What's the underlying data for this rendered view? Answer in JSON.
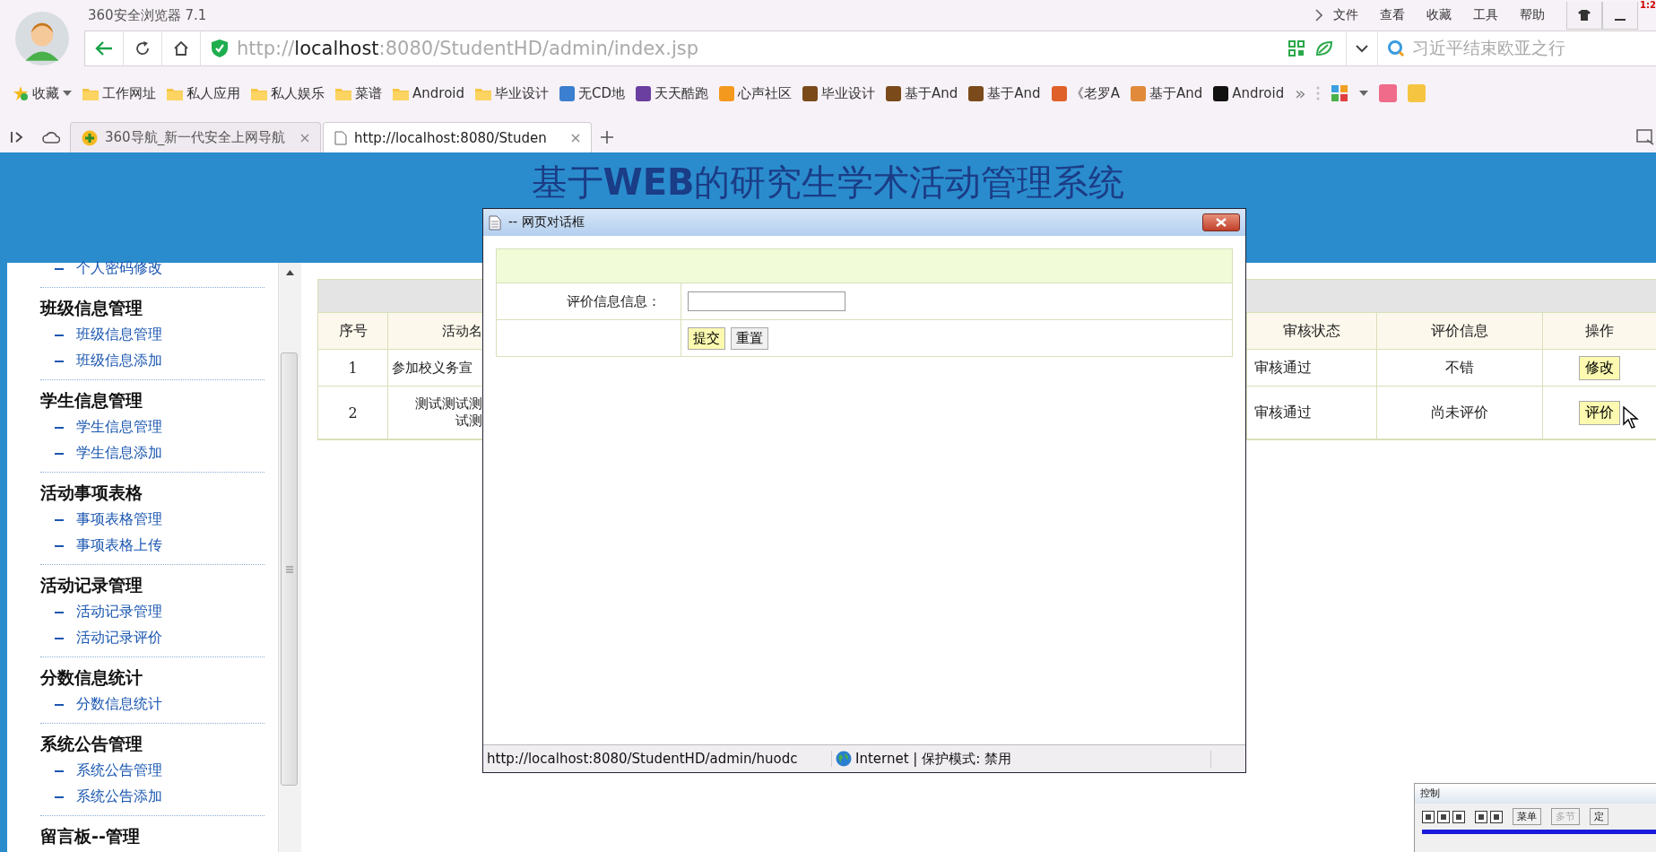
{
  "browser": {
    "app_title": "360安全浏览器 7.1",
    "menu": [
      "文件",
      "查看",
      "收藏",
      "工具",
      "帮助"
    ],
    "clock": "1:2",
    "address": "http://**localhost**:8080/StudentHD/admin/index.jsp",
    "search": {
      "placeholder": "习近平结束欧亚之行"
    },
    "bookmarks": [
      {
        "label": "收藏",
        "kind": "star"
      },
      {
        "label": "工作网址",
        "kind": "folder"
      },
      {
        "label": "私人应用",
        "kind": "folder"
      },
      {
        "label": "私人娱乐",
        "kind": "folder"
      },
      {
        "label": "菜谱",
        "kind": "folder"
      },
      {
        "label": "Android",
        "kind": "folder"
      },
      {
        "label": "毕业设计",
        "kind": "folder"
      },
      {
        "label": "无CD地",
        "kind": "site",
        "color": "#3a7fd0"
      },
      {
        "label": "天天酷跑",
        "kind": "site",
        "color": "#6a3fa0"
      },
      {
        "label": "心声社区",
        "kind": "site",
        "color": "#f39a1e"
      },
      {
        "label": "毕业设计",
        "kind": "site",
        "color": "#7a4a1a"
      },
      {
        "label": "基于And",
        "kind": "site",
        "color": "#7a4a1a"
      },
      {
        "label": "基于And",
        "kind": "site",
        "color": "#7a4a1a"
      },
      {
        "label": "《老罗A",
        "kind": "site",
        "color": "#e0602a"
      },
      {
        "label": "基于And",
        "kind": "site",
        "color": "#e08a3a"
      },
      {
        "label": "Android",
        "kind": "site",
        "color": "#111111"
      }
    ],
    "more": "»",
    "tabs": [
      {
        "title": "360导航_新一代安全上网导航",
        "selected": false
      },
      {
        "title": "http://localhost:8080/Studen",
        "selected": true
      }
    ]
  },
  "page": {
    "title": "基于**WEB**的研究生学术活动管理系统",
    "sidebar": [
      {
        "children": [
          "个人密码修改"
        ]
      },
      {
        "heading": "班级信息管理",
        "children": [
          "班级信息管理",
          "班级信息添加"
        ]
      },
      {
        "heading": "学生信息管理",
        "children": [
          "学生信息管理",
          "学生信息添加"
        ]
      },
      {
        "heading": "活动事项表格",
        "children": [
          "事项表格管理",
          "事项表格上传"
        ]
      },
      {
        "heading": "活动记录管理",
        "children": [
          "活动记录管理",
          "活动记录评价"
        ]
      },
      {
        "heading": "分数信息统计",
        "children": [
          "分数信息统计"
        ]
      },
      {
        "heading": "系统公告管理",
        "children": [
          "系统公告管理",
          "系统公告添加"
        ]
      },
      {
        "heading": "留言板--管理"
      }
    ],
    "table": {
      "columns": [
        "序号",
        "活动名",
        "审核状态",
        "评价信息",
        "操作"
      ],
      "rows": [
        {
          "no": "1",
          "name": [
            "参加校义务宣"
          ],
          "status": "审核通过",
          "review": "不错",
          "action": "修改"
        },
        {
          "no": "2",
          "name": [
            "测试测试测",
            "试测"
          ],
          "status": "审核通过",
          "review": "尚未评价",
          "action": "评价"
        }
      ]
    }
  },
  "dialog": {
    "title": "-- 网页对话框",
    "field_label": "评价信息信息：",
    "buttons": [
      {
        "label": "提交",
        "focused": true
      },
      {
        "label": "重置",
        "focused": false
      }
    ],
    "status_url": "http://localhost:8080/StudentHD/admin/huodc",
    "status_zone": "Internet | 保护模式: 禁用"
  },
  "recorder": {
    "title": "控制",
    "buttons": [
      {
        "label": "菜单",
        "disabled": false
      },
      {
        "label": "多节",
        "disabled": true
      },
      {
        "label": "定",
        "disabled": false
      }
    ]
  }
}
